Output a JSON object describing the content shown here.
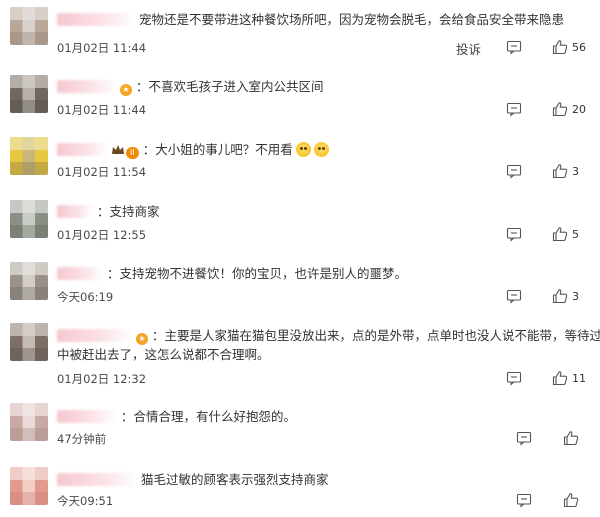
{
  "report_label": "投诉",
  "comments": [
    {
      "text": "宠物还是不要带进这种餐饮场所吧，因为宠物会脱毛，会给食品安全带来隐患",
      "time": "01月02日 11:44",
      "likes": "56",
      "show_report": true,
      "avatar_colors": [
        "#b9a898",
        "#d9d2cc",
        "#8c7b70",
        "#e6e1dc"
      ]
    },
    {
      "text": "：不喜欢毛孩子进入室内公共区间",
      "time": "01月02日 11:44",
      "likes": "20",
      "avatar_colors": [
        "#6f6760",
        "#b6b0aa",
        "#4d4844",
        "#d6d0cb"
      ]
    },
    {
      "text": "：大小姐的事儿吧？不用看",
      "time": "01月02日 11:54",
      "likes": "3",
      "level": "II",
      "avatar_colors": [
        "#e8c840",
        "#c9b77a",
        "#7a6d4c",
        "#efe5b4"
      ]
    },
    {
      "text": "：支持商家",
      "time": "01月02日 12:55",
      "likes": "5",
      "avatar_colors": [
        "#8a8f86",
        "#c8ccc5",
        "#5c6256",
        "#e2e4e0"
      ]
    },
    {
      "text": "：支持宠物不进餐饮！你的宝贝，也许是别人的噩梦。",
      "time": "今天06:19",
      "likes": "3",
      "avatar_colors": [
        "#9a9289",
        "#d3cec8",
        "#6a625a",
        "#e9e5e1"
      ]
    },
    {
      "text": "：主要是人家猫在猫包里没放出来，点的是外带，点单时也没人说不能带，等待过程",
      "text2": "中被赶出去了，这怎么说都不合理啊。",
      "time": "01月02日 12:32",
      "likes": "11",
      "avatar_colors": [
        "#7d6f66",
        "#c4bbb4",
        "#534a44",
        "#ddd6d1"
      ]
    },
    {
      "text": "：合情合理，有什么好抱怨的。",
      "time": "47分钟前",
      "likes": "",
      "avatar_colors": [
        "#c9a9a4",
        "#ead9d6",
        "#a08680",
        "#f4ecea"
      ]
    },
    {
      "text": "猫毛过敏的顾客表示强烈支持商家",
      "time": "今天09:51",
      "likes": "",
      "avatar_colors": [
        "#e29a8e",
        "#f2cec7",
        "#c87b70",
        "#f8e6e2"
      ]
    }
  ]
}
